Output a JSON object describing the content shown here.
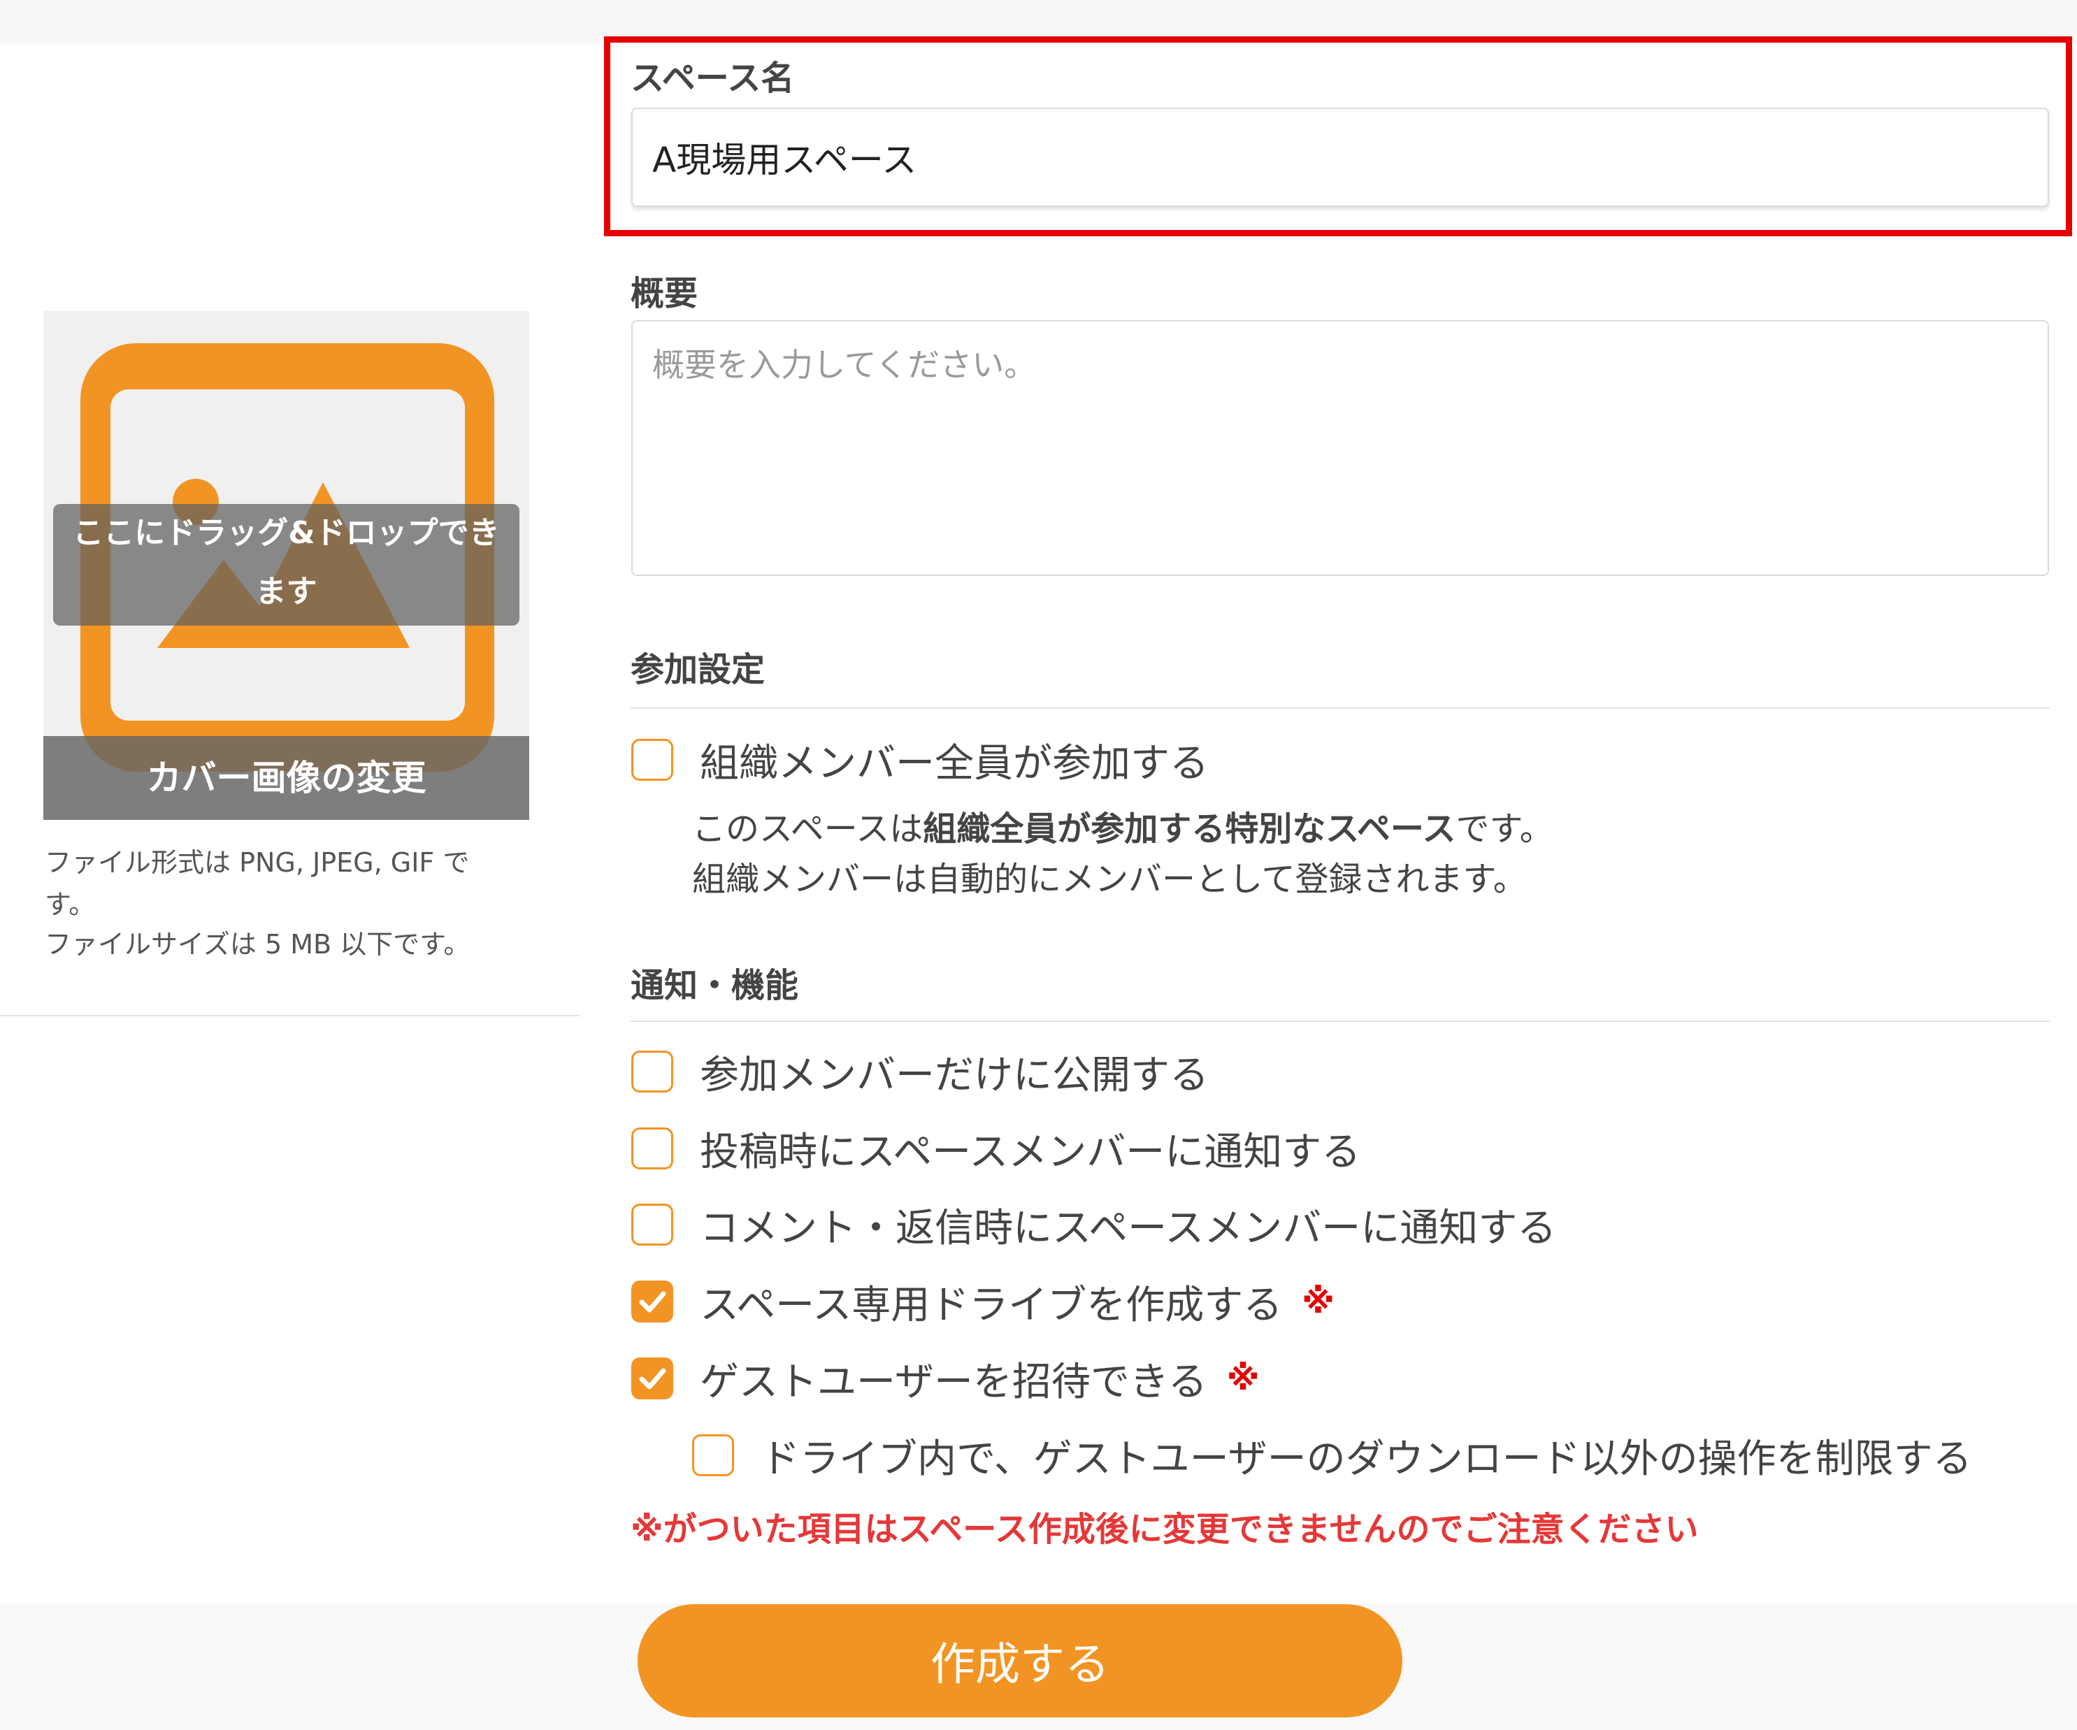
{
  "cover": {
    "drop_hint": "ここにドラッグ&ドロップできます",
    "change_label": "カバー画像の変更",
    "note_line1": "ファイル形式は PNG, JPEG, GIF で",
    "note_line2": "す。",
    "note_line3": "ファイルサイズは 5 MB 以下です。",
    "icon": "image-placeholder-icon",
    "icon_color": "#f29423"
  },
  "space_name": {
    "label": "スペース名",
    "value": "A現場用スペース"
  },
  "overview": {
    "label": "概要",
    "placeholder": "概要を入力してください。"
  },
  "participation": {
    "heading": "参加設定",
    "all_members": {
      "label": "組織メンバー全員が参加する",
      "checked": false
    },
    "desc_prefix": "このスペースは",
    "desc_bold": "組織全員が参加する特別なスペース",
    "desc_suffix": "です。",
    "desc_line2": "組織メンバーは自動的にメンバーとして登録されます。"
  },
  "features": {
    "heading": "通知・機能",
    "options": [
      {
        "label": "参加メンバーだけに公開する",
        "checked": false,
        "mark": ""
      },
      {
        "label": "投稿時にスペースメンバーに通知する",
        "checked": false,
        "mark": ""
      },
      {
        "label": "コメント・返信時にスペースメンバーに通知する",
        "checked": false,
        "mark": ""
      },
      {
        "label": "スペース専用ドライブを作成する",
        "checked": true,
        "mark": "※"
      },
      {
        "label": "ゲストユーザーを招待できる",
        "checked": true,
        "mark": "※"
      }
    ],
    "sub_option": {
      "label": "ドライブ内で、ゲストユーザーのダウンロード以外の操作を制限する",
      "checked": false
    }
  },
  "warning": "※がついた項目はスペース作成後に変更できませんのでご注意ください",
  "create_button": "作成する",
  "colors": {
    "accent": "#f29423",
    "highlight": "#e60000",
    "warning": "#e53838"
  }
}
